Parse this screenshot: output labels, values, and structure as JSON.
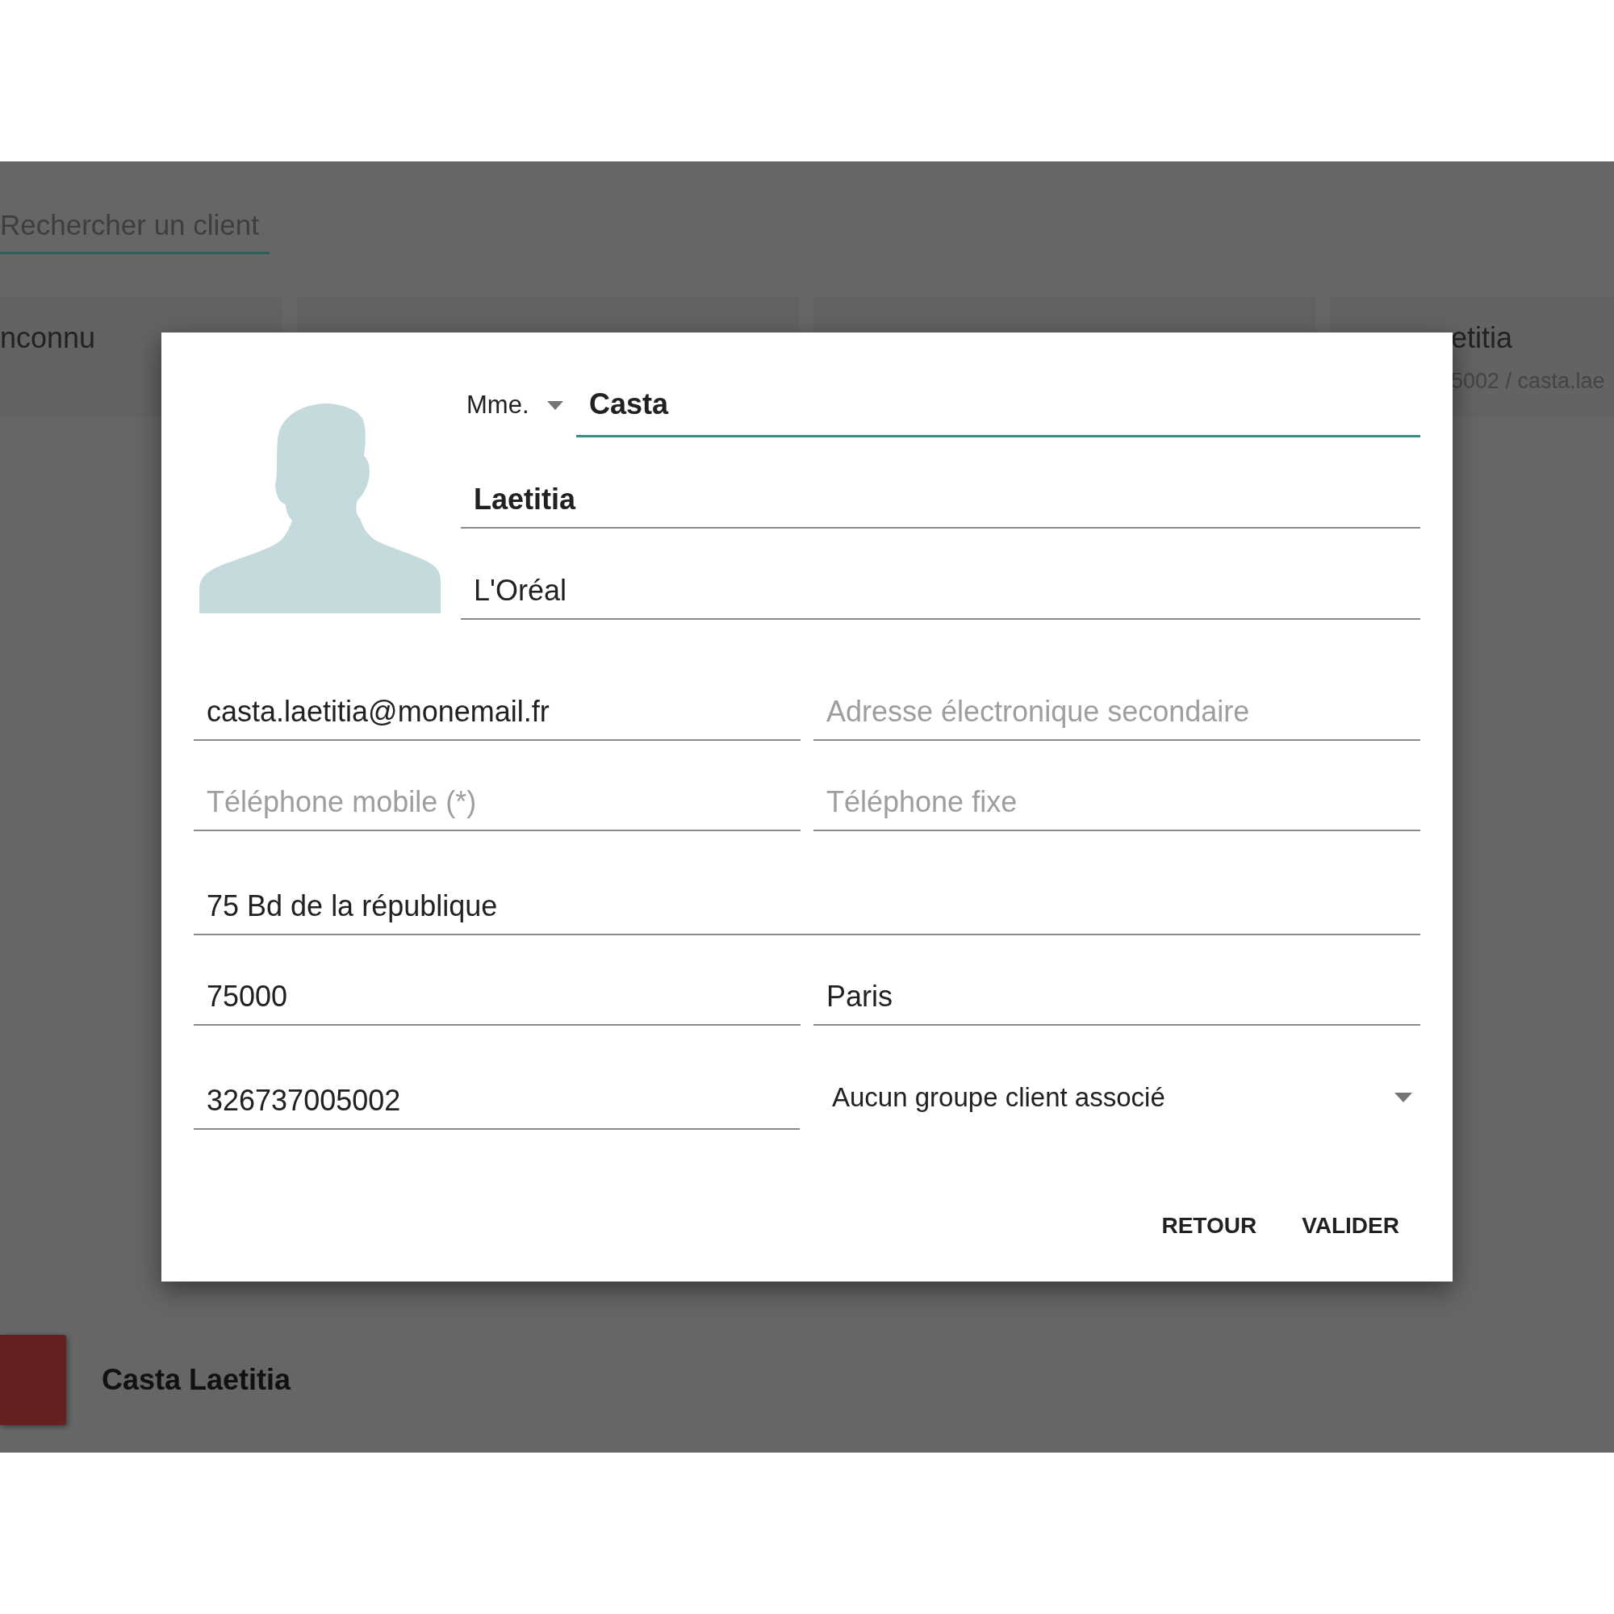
{
  "search": {
    "placeholder": "Rechercher un client"
  },
  "cards": [
    {
      "kind": "visible",
      "title": "nconnu"
    },
    {
      "kind": "covered"
    },
    {
      "kind": "covered"
    },
    {
      "kind": "visible",
      "title": "etitia",
      "subtitle": "5002 / casta.lae"
    }
  ],
  "dialog": {
    "civility": "Mme.",
    "last_name": "Casta",
    "first_name": "Laetitia",
    "company": "L'Oréal",
    "rows": [
      [
        {
          "value": "casta.laetitia@monemail.fr"
        },
        {
          "placeholder": "Adresse électronique secondaire"
        }
      ],
      [
        {
          "placeholder": "Téléphone mobile (*)"
        },
        {
          "placeholder": "Téléphone fixe"
        }
      ],
      [
        {
          "value": "75 Bd de la république"
        }
      ],
      [
        {
          "value": "75000"
        },
        {
          "value": "Paris"
        }
      ],
      [
        {
          "kind": "input",
          "value": "326737005002"
        },
        {
          "kind": "select",
          "value": "Aucun groupe client associé"
        }
      ]
    ],
    "buttons": [
      "RETOUR",
      "VALIDER"
    ]
  },
  "footer": {
    "name": "Casta Laetitia"
  }
}
